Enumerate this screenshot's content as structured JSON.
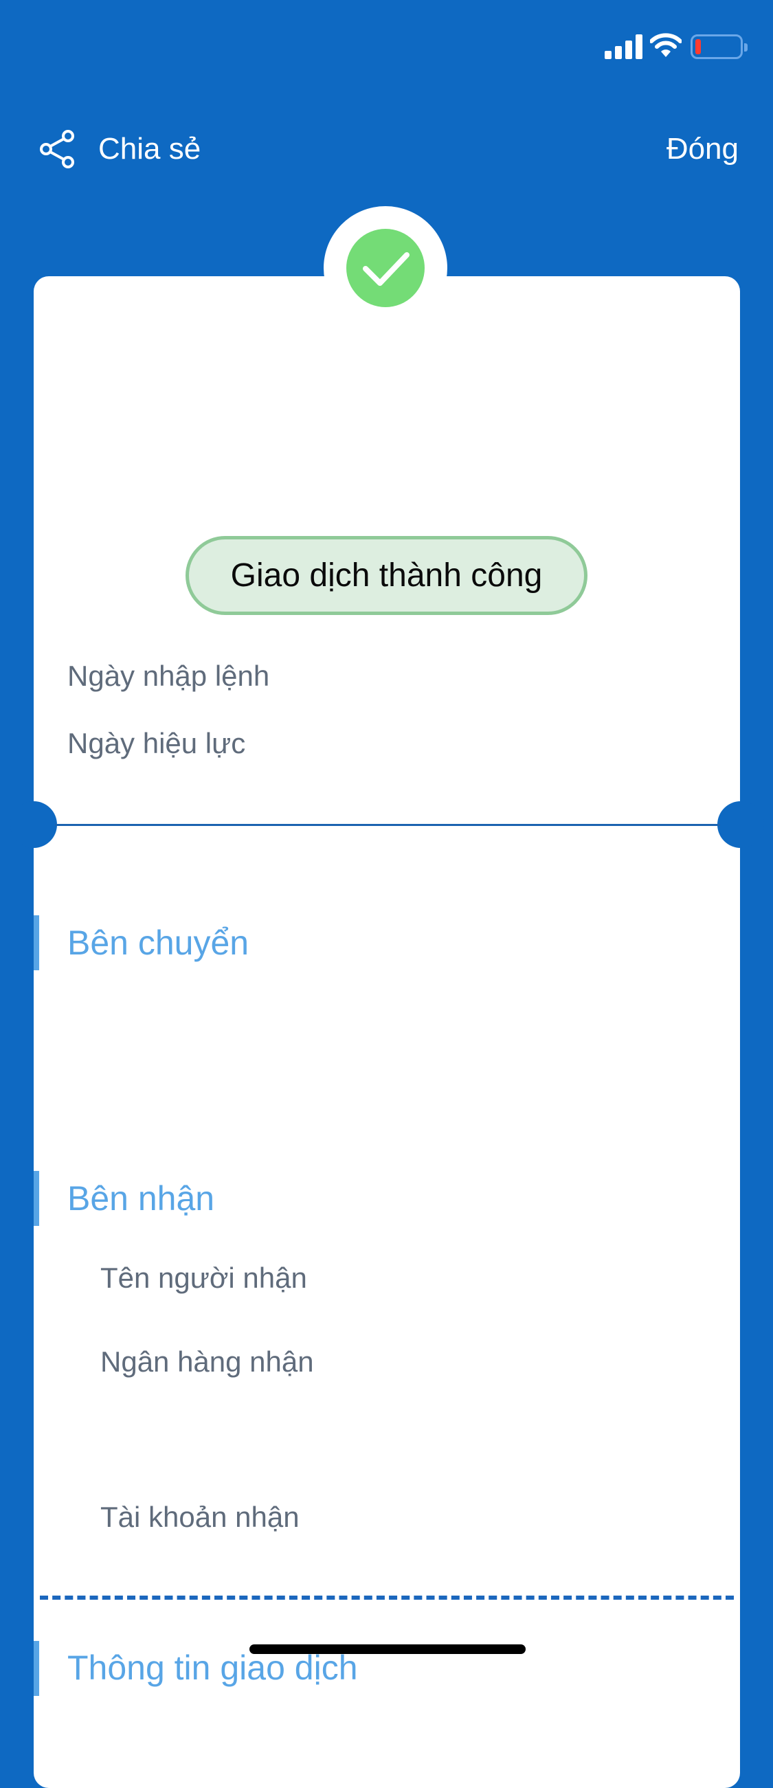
{
  "status_bar": {
    "icons": [
      "cellular-signal-icon",
      "wifi-icon",
      "battery-icon"
    ],
    "battery_level_percent": 10
  },
  "nav": {
    "share_label": "Chia sẻ",
    "close_label": "Đóng"
  },
  "receipt": {
    "status_label": "Giao dịch thành công",
    "order_date_label": "Ngày nhập lệnh",
    "effective_date_label": "Ngày hiệu lực",
    "sender_section_title": "Bên chuyển",
    "receiver_section_title": "Bên nhận",
    "receiver_name_label": "Tên người nhận",
    "receiver_bank_label": "Ngân hàng nhận",
    "receiver_account_label": "Tài khoản nhận",
    "transaction_info_title": "Thông tin giao dịch"
  },
  "colors": {
    "background": "#0e69c2",
    "success_green": "#74dc76",
    "section_accent": "#58a5e6"
  }
}
